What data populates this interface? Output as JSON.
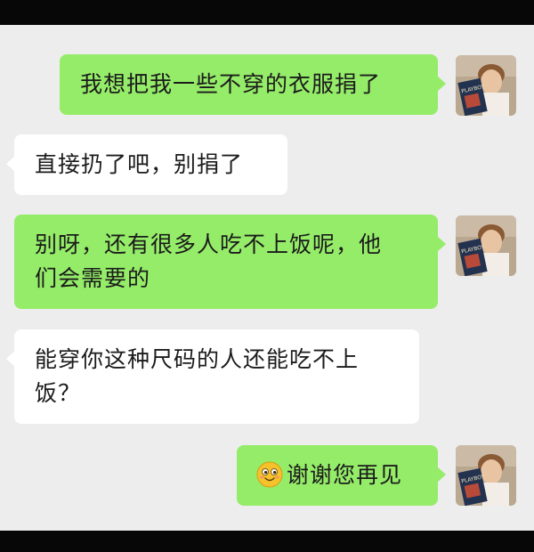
{
  "messages": [
    {
      "side": "sent",
      "text": "我想把我一些不穿的衣服捐了"
    },
    {
      "side": "received",
      "text": "直接扔了吧，别捐了"
    },
    {
      "side": "sent",
      "line1": "别呀，还有很多人吃不上饭呢，他",
      "line2": "们会需要的"
    },
    {
      "side": "received",
      "line1": "能穿你这种尺码的人还能吃不上",
      "line2": "饭？"
    },
    {
      "side": "sent",
      "emoji": "smiling-face-emoji",
      "text": "谢谢您再见"
    }
  ],
  "avatar": {
    "magazine_text": "PLAYBOY"
  },
  "colors": {
    "sent_bubble": "#95ec69",
    "received_bubble": "#ffffff",
    "background": "#ededed",
    "bars": "#070707"
  }
}
